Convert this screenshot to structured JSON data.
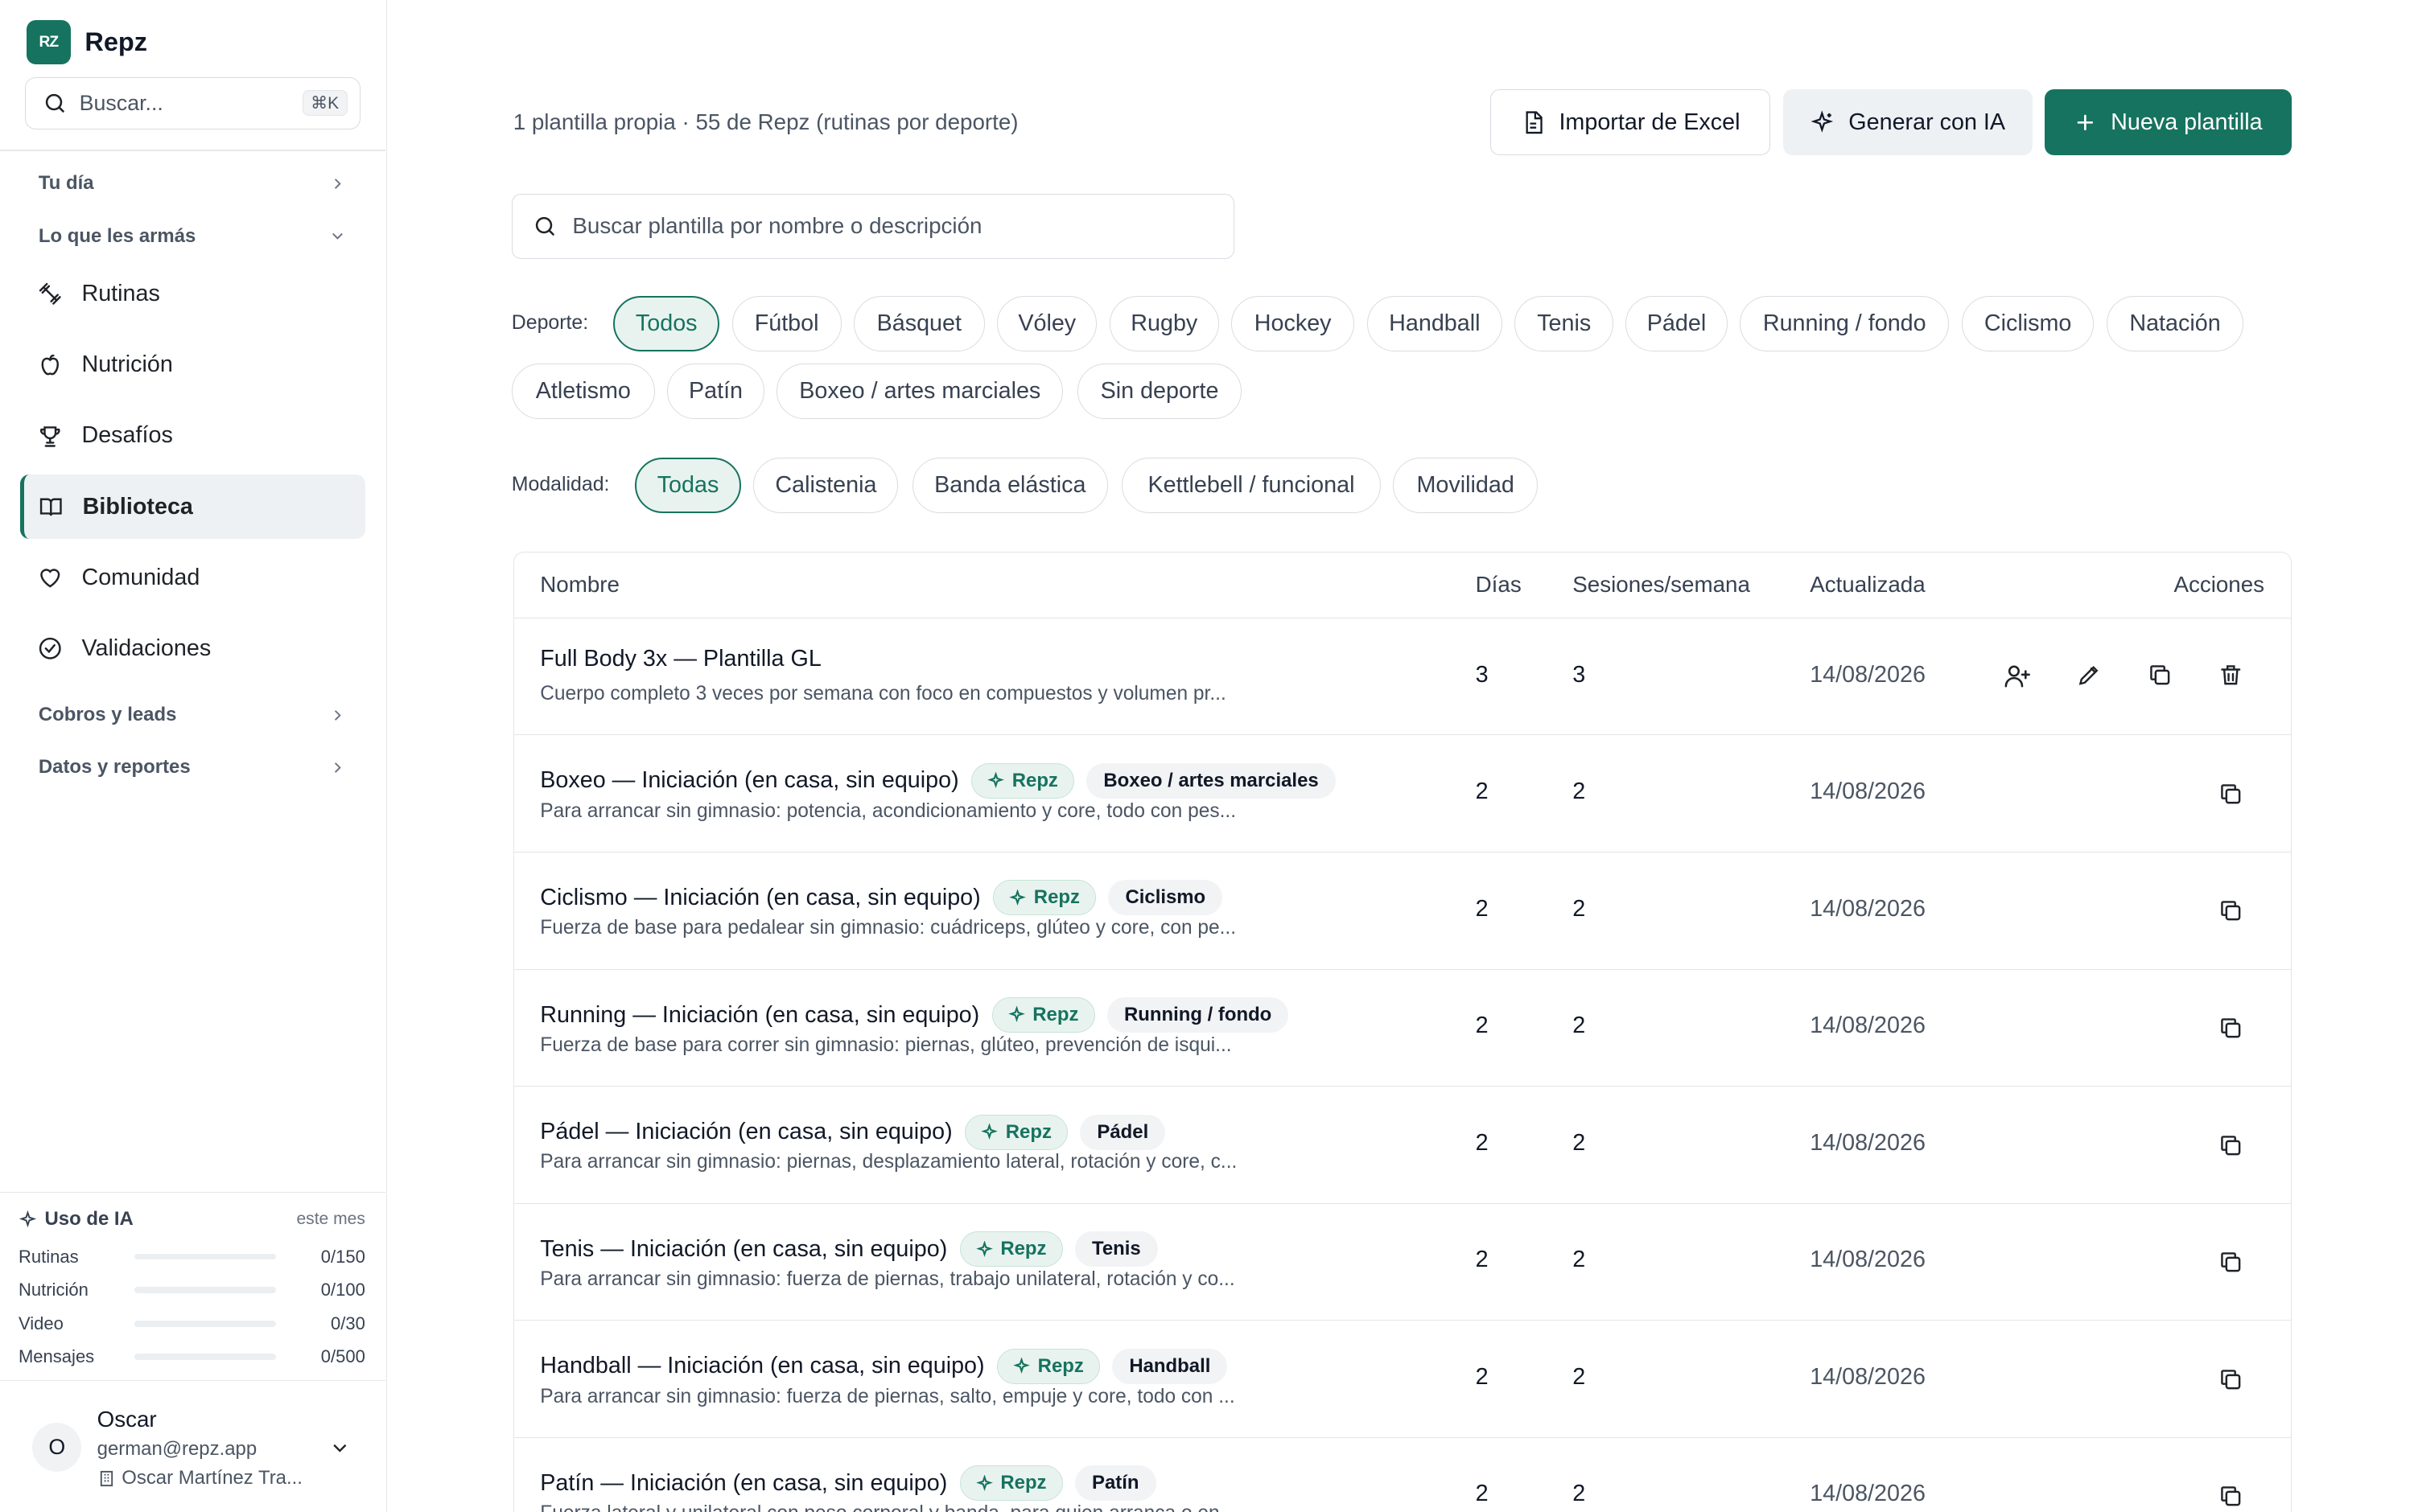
{
  "colors": {
    "accent": "#16735f",
    "accent_soft": "#e8f3ef",
    "border": "#e2e5e9"
  },
  "app": {
    "logo": "RZ",
    "name": "Repz"
  },
  "sidebar": {
    "search_placeholder": "Buscar...",
    "search_shortcut": "⌘K",
    "sections": {
      "tu_dia": "Tu día",
      "lo_que": "Lo que les armás",
      "cobros": "Cobros y leads",
      "datos": "Datos y reportes"
    },
    "items": [
      {
        "label": "Rutinas",
        "icon": "dumbbell-icon"
      },
      {
        "label": "Nutrición",
        "icon": "apple-icon"
      },
      {
        "label": "Desafíos",
        "icon": "trophy-icon"
      },
      {
        "label": "Biblioteca",
        "icon": "book-icon",
        "active": true
      },
      {
        "label": "Comunidad",
        "icon": "heart-icon"
      },
      {
        "label": "Validaciones",
        "icon": "check-circle-icon"
      }
    ],
    "usage": {
      "title": "Uso de IA",
      "period": "este mes",
      "rows": [
        {
          "label": "Rutinas",
          "count": "0/150",
          "fraction": 0
        },
        {
          "label": "Nutrición",
          "count": "0/100",
          "fraction": 0
        },
        {
          "label": "Video",
          "count": "0/30",
          "fraction": 0
        },
        {
          "label": "Mensajes",
          "count": "0/500",
          "fraction": 0
        }
      ]
    },
    "user": {
      "initial": "O",
      "name": "Oscar",
      "email": "german@repz.app",
      "org": "Oscar Martínez Tra..."
    }
  },
  "main": {
    "summary": "1 plantilla propia · 55 de Repz (rutinas por deporte)",
    "buttons": {
      "import": "Importar de Excel",
      "ai": "Generar con IA",
      "new": "Nueva plantilla"
    },
    "search_placeholder": "Buscar plantilla por nombre o descripción",
    "sport_label": "Deporte:",
    "sports": [
      "Todos",
      "Fútbol",
      "Básquet",
      "Vóley",
      "Rugby",
      "Hockey",
      "Handball",
      "Tenis",
      "Pádel",
      "Running / fondo",
      "Ciclismo",
      "Natación",
      "Atletismo",
      "Patín",
      "Boxeo / artes marciales",
      "Sin deporte"
    ],
    "modality_label": "Modalidad:",
    "modalities": [
      "Todas",
      "Calistenia",
      "Banda elástica",
      "Kettlebell / funcional",
      "Movilidad"
    ],
    "table": {
      "headers": {
        "name": "Nombre",
        "days": "Días",
        "sessions": "Sesiones/semana",
        "updated": "Actualizada",
        "actions": "Acciones"
      },
      "repz_tag": "Repz",
      "rows": [
        {
          "name": "Full Body 3x — Plantilla GL",
          "desc": "Cuerpo completo 3 veces por semana con foco en compuestos y volumen pr...",
          "days": "3",
          "sessions": "3",
          "updated": "14/08/2026",
          "own": true
        },
        {
          "name": "Boxeo — Iniciación (en casa, sin equipo)",
          "sport": "Boxeo / artes marciales",
          "desc": "Para arrancar sin gimnasio: potencia, acondicionamiento y core, todo con pes...",
          "days": "2",
          "sessions": "2",
          "updated": "14/08/2026"
        },
        {
          "name": "Ciclismo — Iniciación (en casa, sin equipo)",
          "sport": "Ciclismo",
          "desc": "Fuerza de base para pedalear sin gimnasio: cuádriceps, glúteo y core, con pe...",
          "days": "2",
          "sessions": "2",
          "updated": "14/08/2026"
        },
        {
          "name": "Running — Iniciación (en casa, sin equipo)",
          "sport": "Running / fondo",
          "desc": "Fuerza de base para correr sin gimnasio: piernas, glúteo, prevención de isqui...",
          "days": "2",
          "sessions": "2",
          "updated": "14/08/2026"
        },
        {
          "name": "Pádel — Iniciación (en casa, sin equipo)",
          "sport": "Pádel",
          "desc": "Para arrancar sin gimnasio: piernas, desplazamiento lateral, rotación y core, c...",
          "days": "2",
          "sessions": "2",
          "updated": "14/08/2026"
        },
        {
          "name": "Tenis — Iniciación (en casa, sin equipo)",
          "sport": "Tenis",
          "desc": "Para arrancar sin gimnasio: fuerza de piernas, trabajo unilateral, rotación y co...",
          "days": "2",
          "sessions": "2",
          "updated": "14/08/2026"
        },
        {
          "name": "Handball — Iniciación (en casa, sin equipo)",
          "sport": "Handball",
          "desc": "Para arrancar sin gimnasio: fuerza de piernas, salto, empuje y core, todo con ...",
          "days": "2",
          "sessions": "2",
          "updated": "14/08/2026"
        },
        {
          "name": "Patín — Iniciación (en casa, sin equipo)",
          "sport": "Patín",
          "desc": "Fuerza lateral y unilateral con peso corporal y banda, para quien arranca o en...",
          "days": "2",
          "sessions": "2",
          "updated": "14/08/2026"
        }
      ]
    }
  }
}
